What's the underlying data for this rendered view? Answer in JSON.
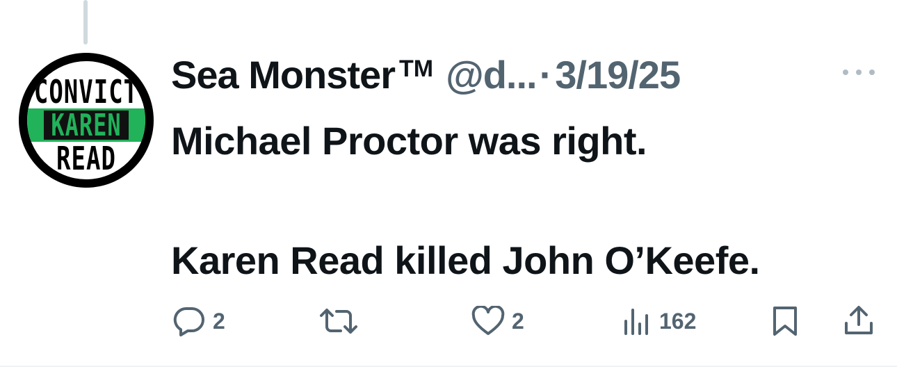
{
  "avatar": {
    "line1": "CONVICT",
    "line2": "KAREN",
    "line3": "READ",
    "colors": {
      "ring": "#000000",
      "band": "#21b25a"
    }
  },
  "header": {
    "display_name": "Sea Monster",
    "trademark": "TM",
    "handle": "@d...",
    "separator": "·",
    "date": "3/19/25"
  },
  "tweet": {
    "text": "Michael Proctor was right.\n\nKaren Read killed John O’Keefe."
  },
  "actions": {
    "reply_count": "2",
    "repost_count": "",
    "like_count": "2",
    "views_count": "162"
  },
  "colors": {
    "text": "#0f1419",
    "secondary": "#536471",
    "icon": "#536471"
  }
}
